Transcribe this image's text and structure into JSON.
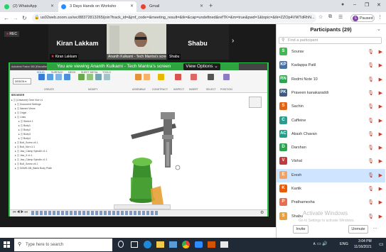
{
  "browser": {
    "tabs": [
      {
        "label": "(2) WhatsApp",
        "color": "#25d366"
      },
      {
        "label": "3 Days Hands on Worksho",
        "color": "#2d8cff"
      },
      {
        "label": "Gmail",
        "color": "#ea4335"
      }
    ],
    "new_tab": "+",
    "url": "us02web.zoom.us/wc/88372813265/join?track_id=&jmf_code=&meeting_result=&tk=&cap=undefined&refTK=&m=true&pwd=1&topic=&tk=ZZOp4VWTdRhN...",
    "profile_label": "Paused",
    "profile_initial": "S",
    "window_controls": {
      "minimize": "–",
      "maximize": "❐",
      "close": "✕"
    }
  },
  "meeting": {
    "rec_label": "REC",
    "tiles": [
      {
        "name": "Kiran Lakkam",
        "label": "Kiran Lakkam"
      },
      {
        "name": "",
        "label": "Ananth Kulkarni - Tech Mantra's screen"
      },
      {
        "name": "Shabu",
        "label": "Shabu"
      }
    ],
    "next_arrow": "›",
    "banner": "You are viewing Ananth Kulkarni - Tech Mantra's screen",
    "view_options": "View Options ⌄",
    "app_title": "Autodesk Fusion 360 (Education License)",
    "toolbar_tabs": [
      "SOLID",
      "SURFACE",
      "MESH",
      "SHEET METAL",
      "TOOLS"
    ],
    "toolbar_groups": [
      "CREATE",
      "MODIFY",
      "ASSEMBLE",
      "CONSTRUCT",
      "INSPECT",
      "INSERT",
      "SELECT",
      "POSITION"
    ],
    "design_label": "DESIGN",
    "browser_title": "BROWSER",
    "browser_items": [
      "(Unsaved) Gear Vice v1",
      "Document Settings",
      "Named Views",
      "Origin",
      "Links",
      "Sketch 1",
      "Body1",
      "Body2",
      "Body3",
      "Body4",
      "Bolt_Screw v4:1",
      "Bolt_Nut v1:1",
      "Jaw_Clamp Spindle v1:1",
      "Jaw_3 v1:1",
      "Jaw_Clamp Spindle v1:1",
      "Bolt_Screw v4:1",
      "DDMS-DB_Blank Body Plate"
    ]
  },
  "participants": {
    "title": "Participants (29)",
    "search_placeholder": "Find a participant",
    "list": [
      {
        "initial": "S",
        "name": "Sourav",
        "color": "#3fb950"
      },
      {
        "initial": "KP",
        "name": "Kadappa Patil",
        "color": "#4a6fa5"
      },
      {
        "initial": "RN",
        "name": "Redmi Note 10",
        "color": "#2ea44f"
      },
      {
        "initial": "PK",
        "name": "Praveen kanakaraddi",
        "color": "#3d5a80"
      },
      {
        "initial": "S",
        "name": "Sachin",
        "color": "#e36414"
      },
      {
        "initial": "C",
        "name": "Caffeine",
        "color": "#2a9d8f"
      },
      {
        "initial": "AC",
        "name": "Akash Chavan",
        "color": "#1f9e89"
      },
      {
        "initial": "D",
        "name": "Darshan",
        "color": "#2ea44f"
      },
      {
        "initial": "V",
        "name": "Vishal",
        "color": "#c23b3b"
      },
      {
        "initial": "E",
        "name": "Eresh",
        "color": "#f4a261"
      },
      {
        "initial": "K",
        "name": "Kartik",
        "color": "#e85d04"
      },
      {
        "initial": "P",
        "name": "Prathamesha",
        "color": "#e76f51"
      },
      {
        "initial": "S",
        "name": "Shabu",
        "color": "#e9a23b"
      }
    ],
    "highlighted_index": 9,
    "invite_label": "Invite",
    "unmute_label": "Unmute",
    "watermark_title": "Activate Windows",
    "watermark_sub": "Go to Settings to activate Windows."
  },
  "taskbar": {
    "search_placeholder": "Type here to search",
    "language": "ENG",
    "time": "3:04 PM",
    "date": "11/16/2021"
  },
  "colors": {
    "share_border": "#2fc44a",
    "banner": "#2fa33f",
    "taskbar": "#1f2a36",
    "highlight_row": "#cfe5ff"
  }
}
